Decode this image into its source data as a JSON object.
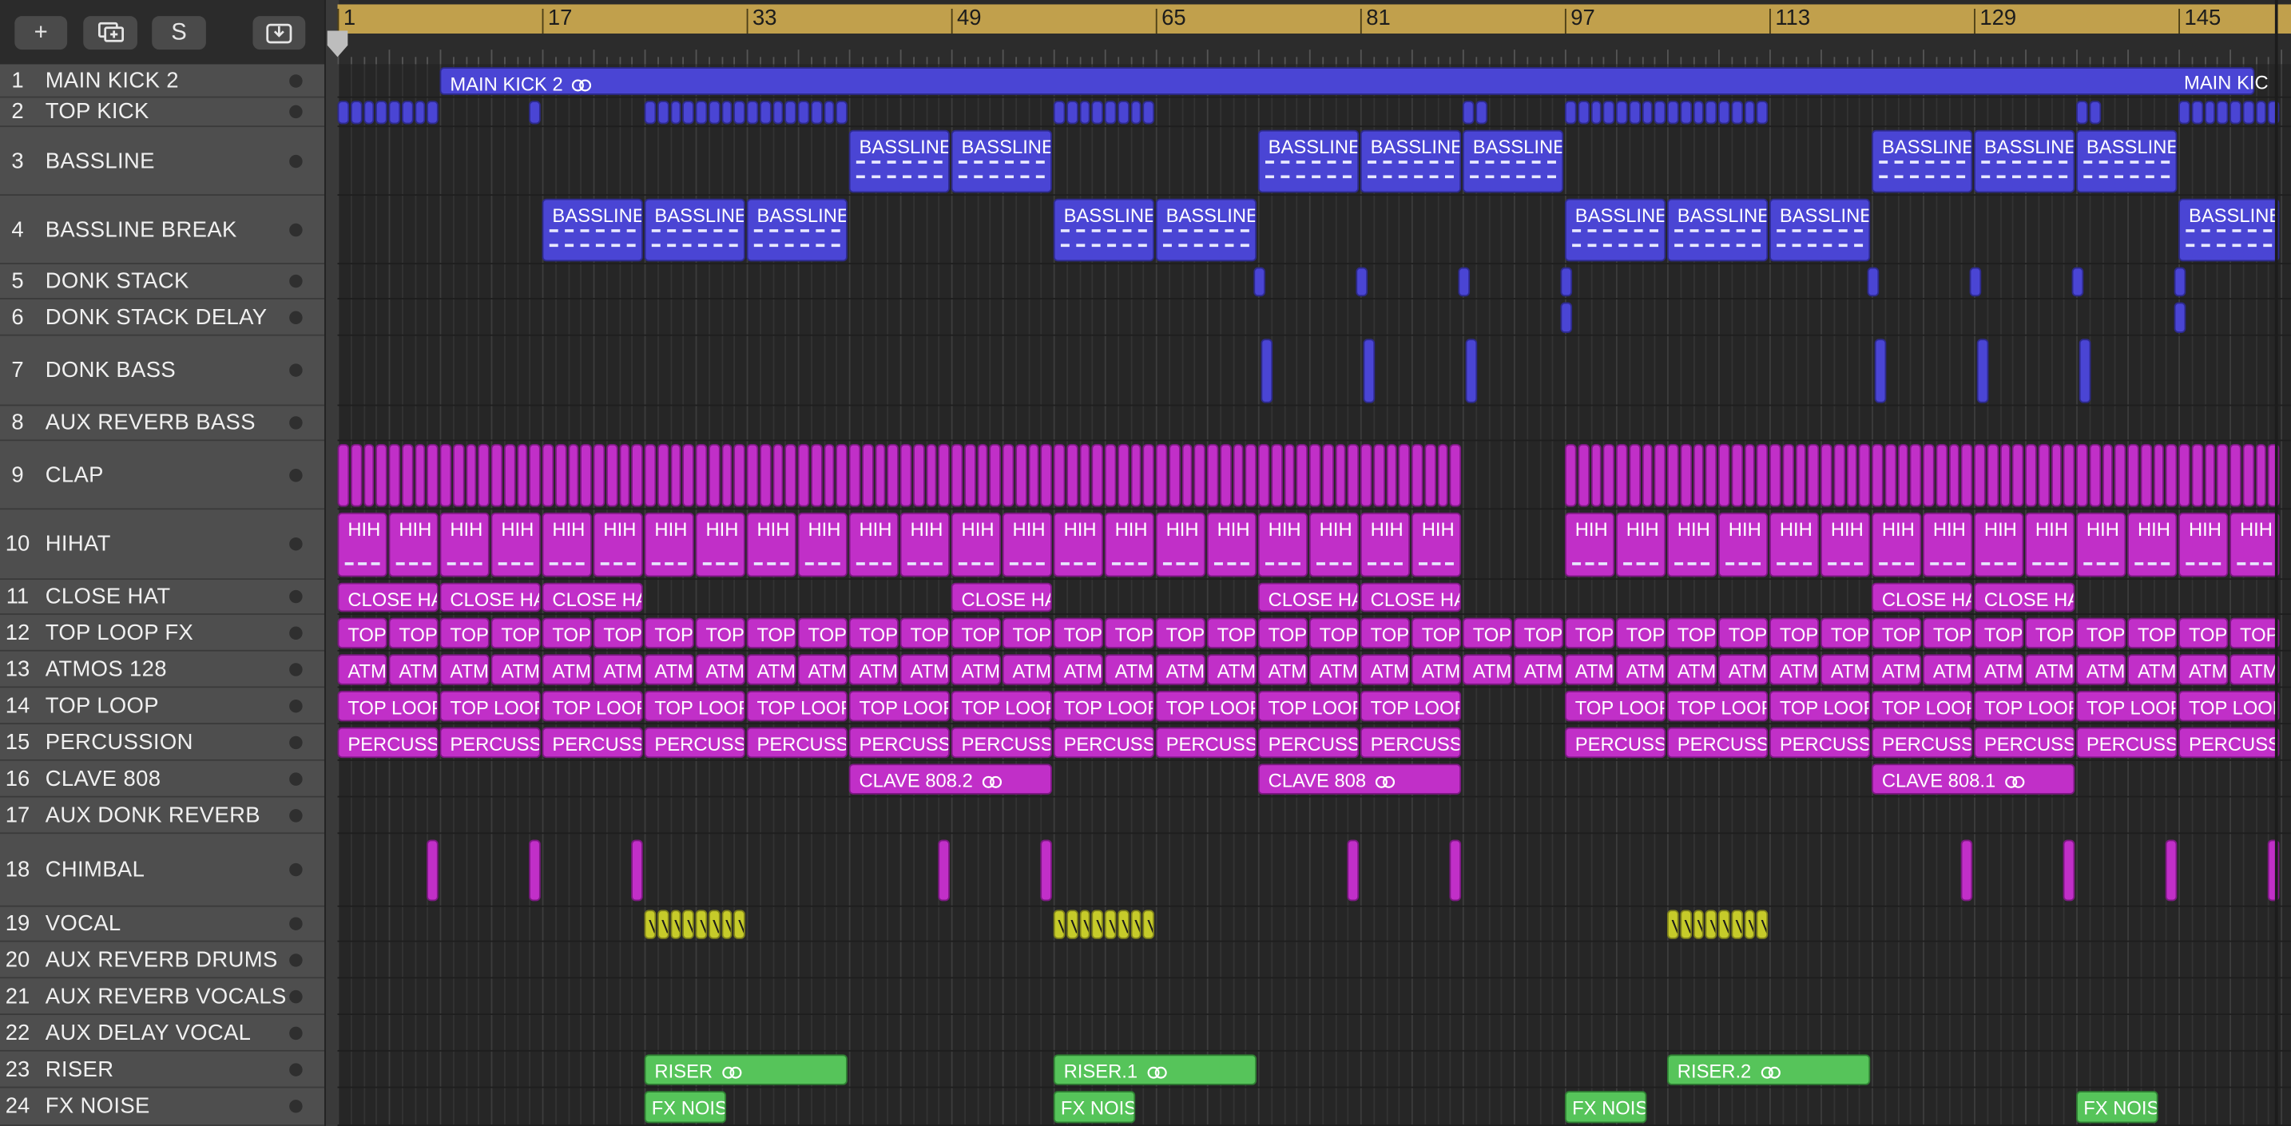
{
  "toolbar": {
    "add_label": "+",
    "solo_label": "S"
  },
  "ruler": {
    "labels": [
      "1",
      "17",
      "33",
      "49",
      "65",
      "81",
      "97",
      "113",
      "129",
      "145"
    ]
  },
  "tracks": [
    {
      "num": "1",
      "name": "MAIN KICK 2"
    },
    {
      "num": "2",
      "name": "TOP KICK"
    },
    {
      "num": "3",
      "name": "BASSLINE"
    },
    {
      "num": "4",
      "name": "BASSLINE BREAK"
    },
    {
      "num": "5",
      "name": "DONK STACK"
    },
    {
      "num": "6",
      "name": "DONK STACK DELAY"
    },
    {
      "num": "7",
      "name": "DONK BASS"
    },
    {
      "num": "8",
      "name": "AUX REVERB BASS"
    },
    {
      "num": "9",
      "name": "CLAP"
    },
    {
      "num": "10",
      "name": "HIHAT"
    },
    {
      "num": "11",
      "name": "CLOSE HAT"
    },
    {
      "num": "12",
      "name": "TOP LOOP FX"
    },
    {
      "num": "13",
      "name": "ATMOS 128"
    },
    {
      "num": "14",
      "name": "TOP LOOP"
    },
    {
      "num": "15",
      "name": "PERCUSSION"
    },
    {
      "num": "16",
      "name": "CLAVE 808"
    },
    {
      "num": "17",
      "name": "AUX DONK REVERB"
    },
    {
      "num": "18",
      "name": "CHIMBAL"
    },
    {
      "num": "19",
      "name": "VOCAL"
    },
    {
      "num": "20",
      "name": "AUX REVERB DRUMS"
    },
    {
      "num": "21",
      "name": "AUX REVERB VOCALS"
    },
    {
      "num": "22",
      "name": "AUX DELAY VOCAL"
    },
    {
      "num": "23",
      "name": "RISER"
    },
    {
      "num": "24",
      "name": "FX NOISE"
    }
  ],
  "regions": {
    "main_kick": [
      "MAIN KICK 2",
      "MAIN KIC"
    ],
    "bassline": "BASSLINE",
    "hihat": "HIH",
    "close_hat": "CLOSE HA",
    "top_loop_fx": "TOP",
    "atmos": "ATM",
    "top_loop": [
      "TOP LOOP",
      "TOP LOOP.",
      "TOP LOOP."
    ],
    "percussion": "PERCUSSI",
    "clave": [
      "CLAVE 808.2",
      "CLAVE 808",
      "CLAVE 808.1"
    ],
    "vocal": "V",
    "riser": [
      "RISER",
      "RISER.1",
      "RISER.2"
    ],
    "fx_noise": [
      "FX NOIS",
      "FX NOIS",
      "FX NOIS",
      "FX NOIS"
    ]
  },
  "colors": {
    "blue": "#4a45d4",
    "magenta": "#c12fc8",
    "yellow": "#c6cb2a",
    "green": "#56c45a",
    "ruler": "#c1a04c"
  }
}
